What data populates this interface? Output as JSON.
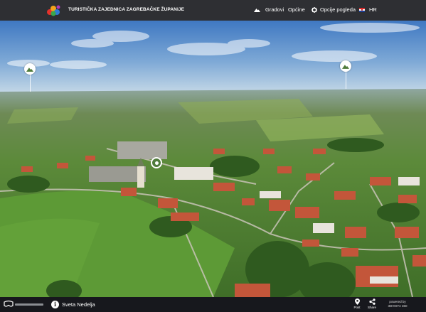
{
  "header": {
    "brand": "TURISTIČKA ZAJEDNICA ZAGREBAČKE ŽUPANIJE",
    "nav": {
      "cities": "Gradovi",
      "municipalities": "Općine",
      "view_options": "Opcije pogleda",
      "language": "HR"
    }
  },
  "pano": {
    "hotspots": [
      {
        "name": "hotspot-left",
        "icon": "mountain-icon"
      },
      {
        "name": "hotspot-right",
        "icon": "mountain-icon"
      }
    ],
    "current_marker_icon": "location-pin-icon"
  },
  "footer": {
    "location": "Sveta Nedelja",
    "buttons": {
      "post": "Post",
      "share": "Share"
    },
    "powered_line1": "powered by",
    "powered_line2": "3DVISTA 360"
  },
  "colors": {
    "bar": "#2e2f33",
    "accent_green": "#4f7b3b",
    "sky": "#7ea9d6"
  }
}
